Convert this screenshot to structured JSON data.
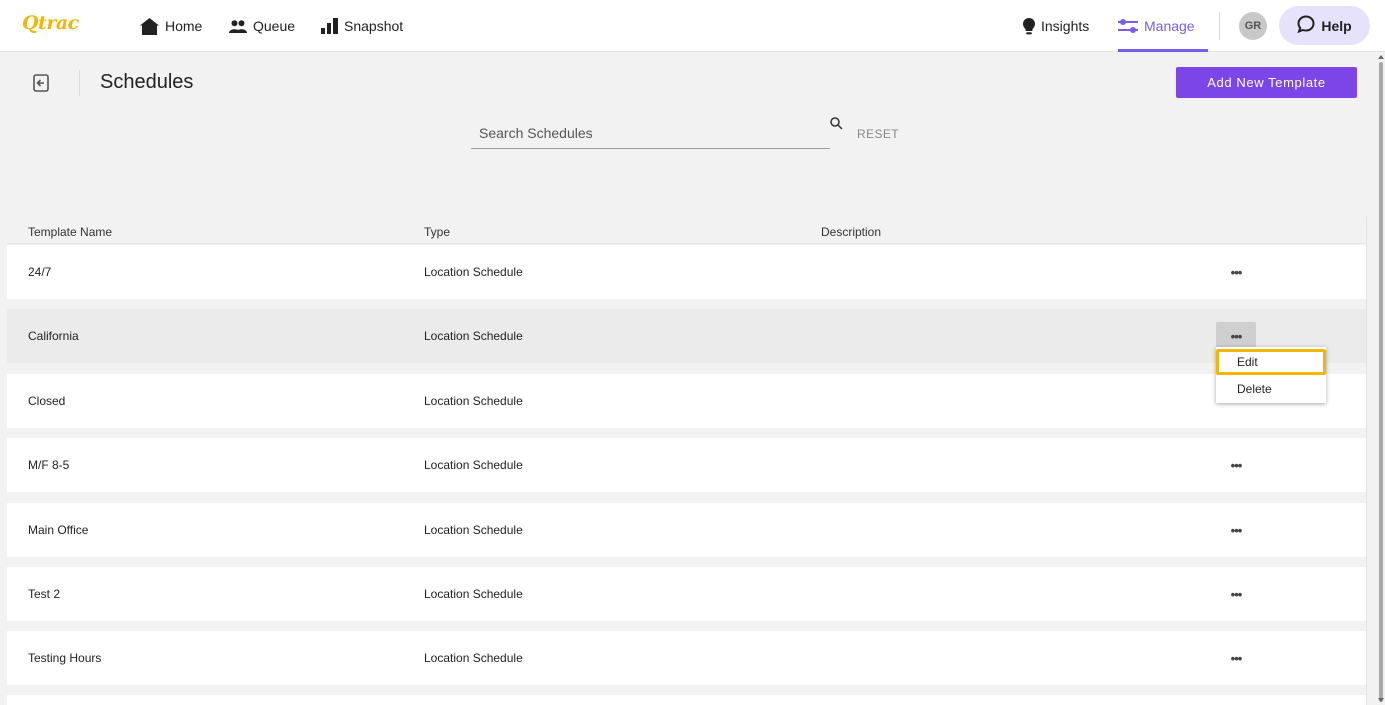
{
  "app": {
    "logo": "Qtrac"
  },
  "nav": {
    "home": "Home",
    "queue": "Queue",
    "snapshot": "Snapshot",
    "insights": "Insights",
    "manage": "Manage",
    "avatar": "GR",
    "help": "Help"
  },
  "page": {
    "title": "Schedules",
    "add_button": "Add New Template",
    "search_placeholder": "Search Schedules",
    "reset": "RESET"
  },
  "table": {
    "columns": [
      "Template Name",
      "Type",
      "Description"
    ],
    "rows": [
      {
        "name": "24/7",
        "type": "Location Schedule",
        "description": ""
      },
      {
        "name": "California",
        "type": "Location Schedule",
        "description": ""
      },
      {
        "name": "Closed",
        "type": "Location Schedule",
        "description": ""
      },
      {
        "name": "M/F 8-5",
        "type": "Location Schedule",
        "description": ""
      },
      {
        "name": "Main Office",
        "type": "Location Schedule",
        "description": ""
      },
      {
        "name": "Test 2",
        "type": "Location Schedule",
        "description": ""
      },
      {
        "name": "Testing Hours",
        "type": "Location Schedule",
        "description": ""
      }
    ],
    "more_label": "•••"
  },
  "context_menu": {
    "edit": "Edit",
    "delete": "Delete"
  },
  "colors": {
    "accent": "#7b45e8",
    "logo": "#f2b705",
    "highlight": "#f2b705"
  }
}
